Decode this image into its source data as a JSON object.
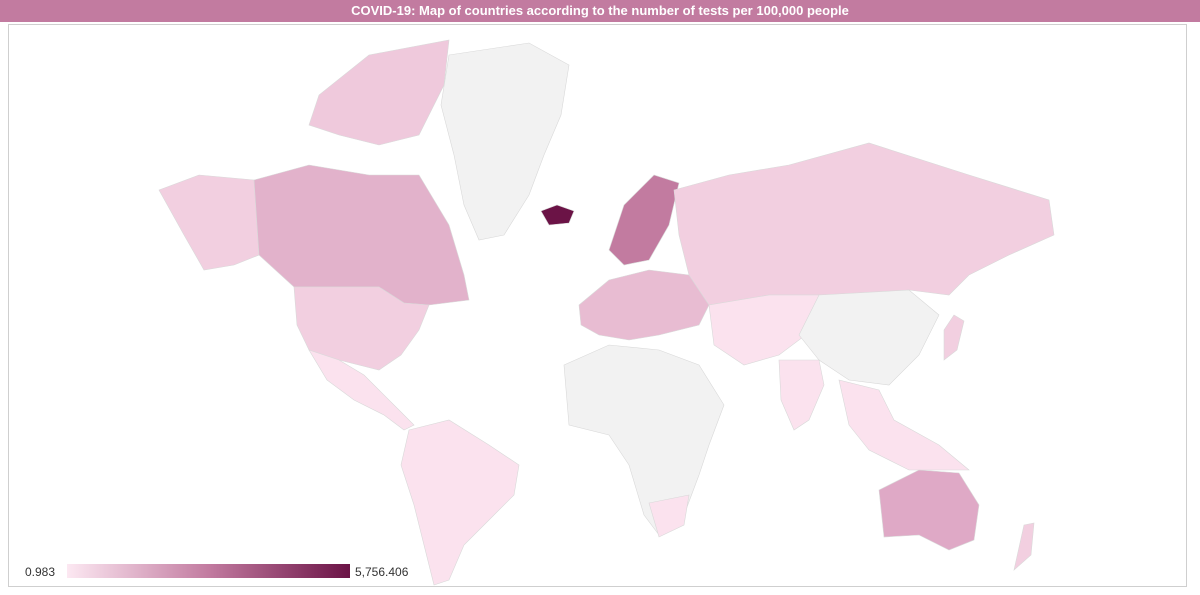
{
  "title": "COVID-19: Map of countries according to the number of tests per 100,000 people",
  "legend": {
    "min_label": "0.983",
    "max_label": "5,756.406",
    "colors": {
      "low": "#fce8f2",
      "mid": "#c27ba0",
      "high": "#6b1346",
      "no_data": "#f2f2f2"
    }
  },
  "colors": {
    "title_bar": "#c27ba0",
    "border": "#d9d9d9"
  }
}
